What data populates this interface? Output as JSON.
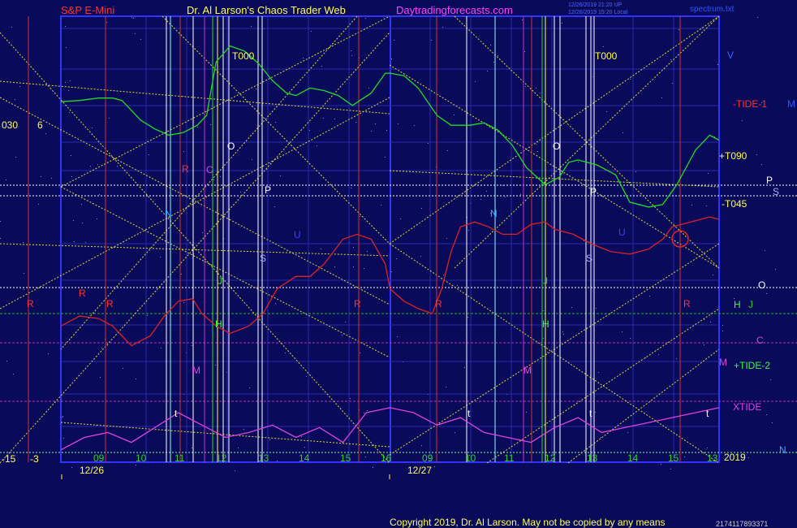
{
  "header": {
    "instrument": "S&P E-Mini",
    "site_title": "Dr. Al Larson's Chaos Trader Web",
    "site_url": "Daytradingforecasts.com",
    "meta_line_1": "12/26/2019 21:20 UP",
    "meta_line_2": "12/26/2019 15:20 Local",
    "file_name": "spectrum.txt"
  },
  "footer": {
    "copyright": "Copyright 2019, Dr. Al Larson. May not be copied by any means",
    "counter": "2174117893371"
  },
  "left_readouts": {
    "top_value_1": "030",
    "top_value_2": "6",
    "bottom_value_1": "-15",
    "bottom_value_2": "-3"
  },
  "year_label": "2019",
  "colors": {
    "background": "#0a0a5a",
    "grid": "#2a2ab0",
    "price_line": "#22dd22",
    "tide": "#dd2222",
    "xtide": "#dd44dd",
    "yellow_lines": "#dddd33",
    "white_lines": "#e8e8ff",
    "frame": "#3333ff"
  },
  "chart_data": {
    "type": "line",
    "title": "",
    "x_axis": {
      "days": [
        "12/26",
        "12/27"
      ],
      "hour_ticks": [
        "09",
        "10",
        "11",
        "12",
        "13",
        "14",
        "15",
        "16",
        "09",
        "10",
        "11",
        "12",
        "13",
        "14",
        "15",
        "13"
      ]
    },
    "right_labels": [
      {
        "text": "V",
        "color": "#3366ff"
      },
      {
        "text": "-TIDE-1",
        "color": "#ff3333"
      },
      {
        "text": "M",
        "color": "#3355ff"
      },
      {
        "text": "+T090",
        "color": "#ffff44"
      },
      {
        "text": "P",
        "color": "#ffffff"
      },
      {
        "text": "S",
        "color": "#aaaaff"
      },
      {
        "text": "-T045",
        "color": "#ffff44"
      },
      {
        "text": "O",
        "color": "#ffffff"
      },
      {
        "text": "H",
        "color": "#33ff33"
      },
      {
        "text": "J",
        "color": "#33cc33"
      },
      {
        "text": "C",
        "color": "#dd44dd"
      },
      {
        "text": "M",
        "color": "#dd44dd"
      },
      {
        "text": "+TIDE-2",
        "color": "#33ff33"
      },
      {
        "text": "XTIDE",
        "color": "#dd44dd"
      },
      {
        "text": "N",
        "color": "#33aaff"
      }
    ],
    "chart_markers": [
      {
        "text": "T000",
        "color": "#ffff44"
      },
      {
        "text": "T000",
        "color": "#ffff44"
      },
      {
        "text": "O",
        "color": "#ffffff"
      },
      {
        "text": "O",
        "color": "#ffffff"
      },
      {
        "text": "P",
        "color": "#ffffff"
      },
      {
        "text": "P",
        "color": "#ffffff"
      },
      {
        "text": "S",
        "color": "#aaaaff"
      },
      {
        "text": "S",
        "color": "#aaaaff"
      },
      {
        "text": "N",
        "color": "#33aaff"
      },
      {
        "text": "N",
        "color": "#33aaff"
      },
      {
        "text": "C",
        "color": "#dd44dd"
      },
      {
        "text": "U",
        "color": "#3344ff"
      },
      {
        "text": "U",
        "color": "#3344ff"
      },
      {
        "text": "J",
        "color": "#33cc33"
      },
      {
        "text": "J",
        "color": "#33cc33"
      },
      {
        "text": "H",
        "color": "#33ff33"
      },
      {
        "text": "H",
        "color": "#33ff33"
      },
      {
        "text": "M",
        "color": "#dd44dd"
      },
      {
        "text": "M",
        "color": "#dd44dd"
      },
      {
        "text": "R",
        "color": "#ff3333"
      },
      {
        "text": "R",
        "color": "#ff3333"
      },
      {
        "text": "R",
        "color": "#ff3333"
      },
      {
        "text": "R",
        "color": "#ff3333"
      },
      {
        "text": "R",
        "color": "#ff3333"
      },
      {
        "text": "R",
        "color": "#ff3333"
      },
      {
        "text": "R",
        "color": "#ff3333"
      },
      {
        "text": "t",
        "color": "#ffffff"
      },
      {
        "text": "t",
        "color": "#ffffff"
      },
      {
        "text": "t",
        "color": "#ffffff"
      },
      {
        "text": "t",
        "color": "#ffffff"
      }
    ],
    "series": [
      {
        "color": "#22dd22",
        "x": [
          0,
          0.4,
          0.8,
          1.1,
          1.3,
          1.5,
          1.7,
          2.0,
          2.3,
          2.6,
          2.9,
          3.1,
          3.3,
          3.6,
          3.9,
          4.2,
          4.5,
          4.8,
          5.0,
          5.3,
          5.6,
          5.9,
          6.2,
          6.6,
          6.9,
          7.0,
          7.3,
          7.6,
          8.0,
          8.3,
          8.7,
          9.0,
          9.3,
          9.6,
          9.9,
          10.3,
          10.6,
          10.8,
          11.0,
          11.4,
          11.8,
          12.1,
          12.5,
          12.8,
          13.1,
          13.5,
          13.8,
          14.0
        ],
        "y": [
          45.5,
          46,
          47,
          47,
          46,
          42,
          38,
          34.5,
          32,
          33,
          36,
          40,
          61.5,
          68,
          66,
          61,
          54,
          49,
          48,
          51,
          50,
          48,
          44,
          49,
          57,
          57,
          56,
          51,
          40,
          36,
          36,
          37,
          34,
          28,
          19,
          12,
          15,
          21,
          22,
          20,
          16,
          5,
          3,
          4,
          12,
          26,
          32,
          30
        ]
      },
      {
        "color": "#dd2222",
        "x": [
          0,
          0.4,
          0.8,
          1.1,
          1.3,
          1.5,
          1.9,
          2.2,
          2.5,
          2.8,
          3.0,
          3.3,
          3.6,
          4.0,
          4.3,
          4.6,
          5.0,
          5.3,
          5.6,
          6.0,
          6.3,
          6.6,
          6.9,
          7.0,
          7.3,
          7.6,
          7.9,
          8.1,
          8.3,
          8.5,
          8.8,
          9.1,
          9.4,
          9.7,
          10.0,
          10.3,
          10.5,
          10.9,
          11.3,
          11.7,
          12.1,
          12.5,
          12.8,
          13.0,
          13.4,
          13.8,
          14.0
        ],
        "y": [
          -45,
          -41,
          -42,
          -45,
          -49,
          -53,
          -49,
          -41,
          -35,
          -34,
          -40,
          -45,
          -48,
          -45,
          -40,
          -30,
          -25,
          -25,
          -20,
          -10,
          -8,
          -10,
          -20,
          -30,
          -35,
          -38,
          -40,
          -30,
          -15,
          -5,
          -3,
          -5,
          -8,
          -8,
          -4,
          -3,
          -6,
          -8,
          -12,
          -15,
          -16,
          -14,
          -10,
          -5,
          -3,
          -1,
          -2
        ]
      },
      {
        "color": "#dd44dd",
        "x": [
          0,
          0.5,
          1.0,
          1.5,
          2.0,
          2.5,
          3.0,
          3.5,
          4.0,
          4.5,
          5.0,
          5.5,
          6.0,
          6.5,
          7.0,
          7.5,
          8.0,
          8.5,
          9.0,
          9.5,
          10.0,
          10.5,
          11.0,
          11.5,
          12.0,
          12.5,
          13.0,
          13.5,
          14.0
        ],
        "y": [
          -95,
          -90,
          -88,
          -92,
          -86,
          -80,
          -85,
          -90,
          -88,
          -85,
          -90,
          -86,
          -92,
          -80,
          -78,
          -80,
          -85,
          -82,
          -88,
          -90,
          -92,
          -86,
          -82,
          -88,
          -86,
          -84,
          -82,
          -80,
          -78
        ]
      }
    ]
  }
}
